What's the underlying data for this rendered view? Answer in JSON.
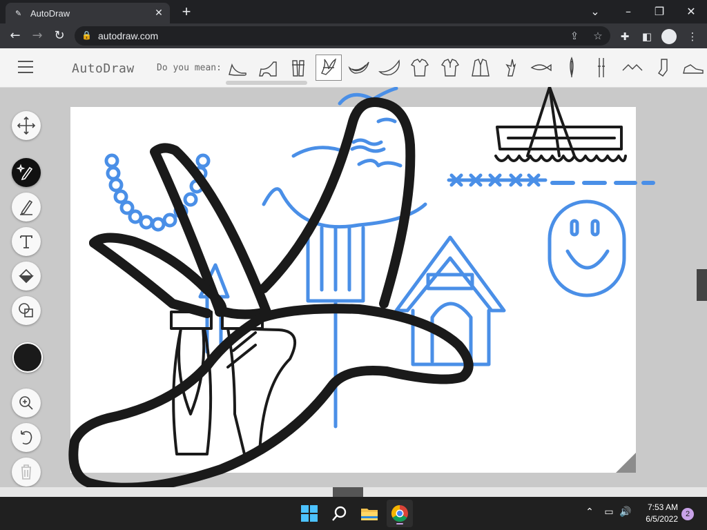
{
  "browser": {
    "tab_title": "AutoDraw",
    "tab_favicon": "autodraw-favicon-icon",
    "url": "autodraw.com",
    "icons": [
      "back-icon",
      "forward-icon",
      "reload-icon",
      "lock-icon",
      "share-icon",
      "star-icon",
      "extensions-icon",
      "sidepanel-icon",
      "profile-icon",
      "kebab-icon"
    ]
  },
  "app": {
    "logo": "AutoDraw",
    "suggestion_prompt": "Do you mean:",
    "suggestions": [
      "high-heel",
      "high-heel",
      "ballet-shoes",
      "palm-tree",
      "banana",
      "banana",
      "shirt",
      "polo-shirt",
      "jacket",
      "hand",
      "fish",
      "feather",
      "skis",
      "bird",
      "sock",
      "shoe"
    ],
    "selected_suggestion_index": 3,
    "tools": [
      "move-icon",
      "autodraw-icon",
      "draw-icon",
      "type-icon",
      "fill-icon",
      "shape-icon",
      "zoom-icon",
      "undo-icon",
      "delete-icon"
    ],
    "active_tool": "autodraw",
    "color": "#1a1a1a",
    "accent_blue": "#4a8fe7"
  },
  "taskbar": {
    "time": "7:53 AM",
    "date": "6/5/2022",
    "notifications": "2",
    "apps": [
      "windows-start-icon",
      "search-icon",
      "file-explorer-icon",
      "chrome-icon"
    ]
  }
}
